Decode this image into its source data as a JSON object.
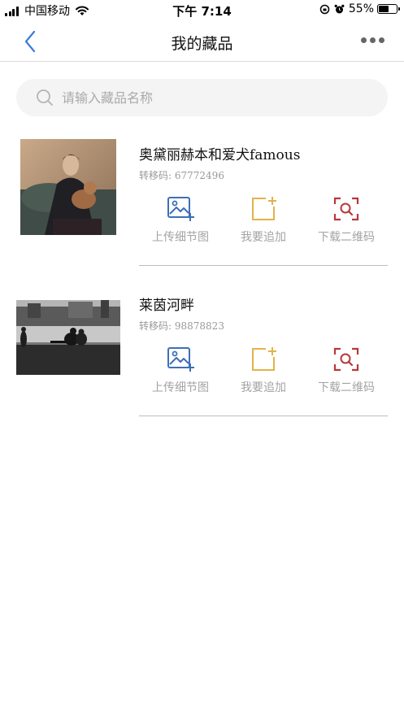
{
  "status_bar": {
    "carrier": "中国移动",
    "time": "下午 7:14",
    "battery": "55%",
    "battery_level": 0.55
  },
  "nav": {
    "title": "我的藏品"
  },
  "search": {
    "placeholder": "请输入藏品名称",
    "value": ""
  },
  "items": [
    {
      "title": "奥黛丽赫本和爱犬famous",
      "code_label": "转移码:",
      "code": "67772496",
      "actions": [
        "上传细节图",
        "我要追加",
        "下载二维码"
      ]
    },
    {
      "title": "莱茵河畔",
      "code_label": "转移码:",
      "code": "98878823",
      "actions": [
        "上传细节图",
        "我要追加",
        "下载二维码"
      ]
    }
  ],
  "colors": {
    "upload_icon": "#3d6fb8",
    "append_icon": "#e2b34a",
    "qrcode_icon": "#b8383a",
    "back_icon": "#3d7bd6",
    "label_gray": "#a3a3a3"
  }
}
